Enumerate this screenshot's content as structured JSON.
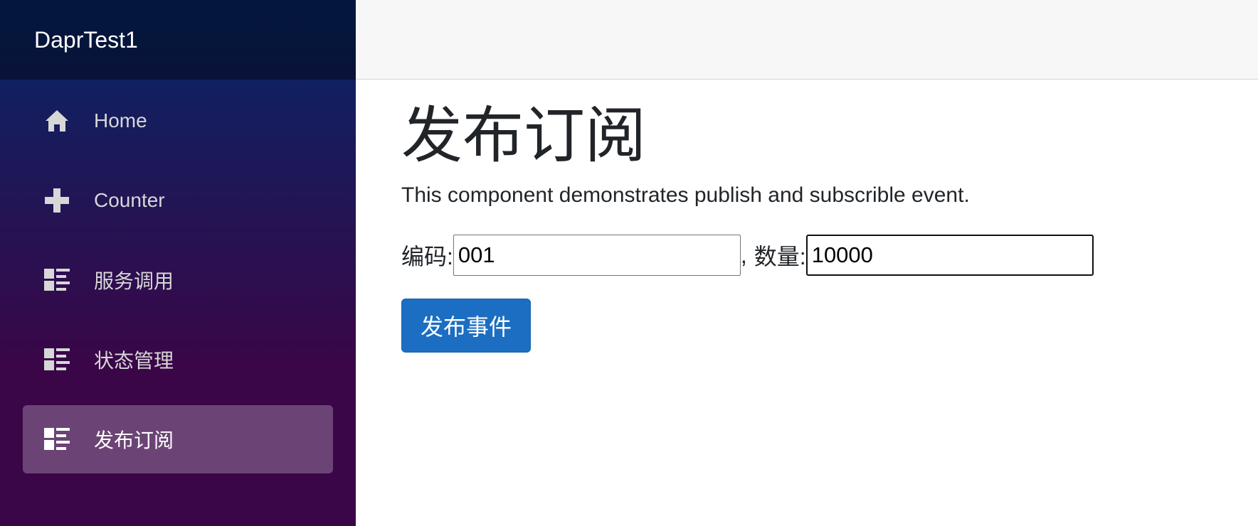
{
  "app": {
    "brand": "DaprTest1"
  },
  "sidebar": {
    "items": [
      {
        "label": "Home",
        "icon": "home-icon",
        "active": false
      },
      {
        "label": "Counter",
        "icon": "plus-icon",
        "active": false
      },
      {
        "label": "服务调用",
        "icon": "list-rich-icon",
        "active": false
      },
      {
        "label": "状态管理",
        "icon": "list-rich-icon",
        "active": false
      },
      {
        "label": "发布订阅",
        "icon": "list-rich-icon",
        "active": true
      }
    ]
  },
  "main": {
    "title": "发布订阅",
    "description": "This component demonstrates publish and subscrible event.",
    "form": {
      "code_label": "编码:",
      "code_value": "001",
      "separator": ",",
      "quantity_label": "数量:",
      "quantity_value": "10000"
    },
    "publish_button": "发布事件"
  },
  "colors": {
    "sidebar_top": "#052767",
    "sidebar_bottom": "#3a0647",
    "button": "#1b6ec2",
    "topbar": "#f7f7f7"
  }
}
